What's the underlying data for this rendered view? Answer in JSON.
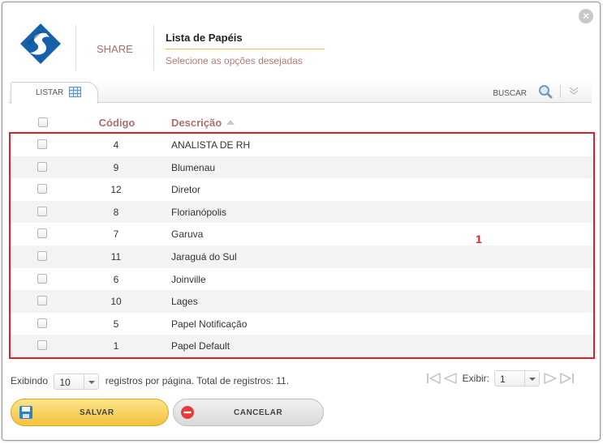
{
  "header": {
    "app_name": "SHARE",
    "title": "Lista de Papéis",
    "subtitle": "Selecione as opções desejadas",
    "close_glyph": "×"
  },
  "tabs": {
    "listar_label": "LISTAR",
    "buscar_label": "BUSCAR"
  },
  "table": {
    "columns": {
      "code": "Código",
      "description": "Descrição"
    },
    "rows": [
      {
        "code": "4",
        "description": "ANALISTA DE RH"
      },
      {
        "code": "9",
        "description": "Blumenau"
      },
      {
        "code": "12",
        "description": "Diretor"
      },
      {
        "code": "8",
        "description": "Florianópolis"
      },
      {
        "code": "7",
        "description": "Garuva"
      },
      {
        "code": "11",
        "description": "Jaraguá do Sul"
      },
      {
        "code": "6",
        "description": "Joinville"
      },
      {
        "code": "10",
        "description": "Lages"
      },
      {
        "code": "5",
        "description": "Papel Notificação"
      },
      {
        "code": "1",
        "description": "Papel Default"
      }
    ]
  },
  "annotation": "1",
  "footer": {
    "showing_label": "Exibindo",
    "page_size": "10",
    "records_text": "registros por página. Total de registros: 11.",
    "exibir_label": "Exibir:",
    "current_page": "1"
  },
  "buttons": {
    "save_label": "SALVAR",
    "cancel_label": "CANCELAR"
  },
  "colors": {
    "accent_red": "#e01f26",
    "header_text": "#a8706e",
    "save_yellow": "#f4c23d",
    "logo_blue": "#1560a8"
  }
}
